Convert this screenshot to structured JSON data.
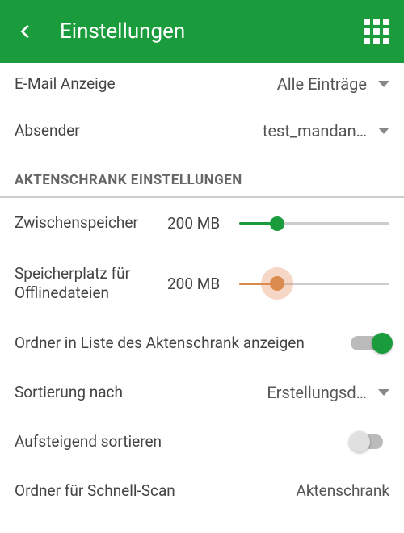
{
  "header": {
    "title": "Einstellungen"
  },
  "email_row": {
    "label": "E-Mail Anzeige",
    "value": "Alle Einträge"
  },
  "sender_row": {
    "label": "Absender",
    "value": "test_mandan…"
  },
  "section": "AKTENSCHRANK EINSTELLUNGEN",
  "cache": {
    "label": "Zwischenspeicher",
    "value": "200 MB",
    "pct": 25,
    "color": "#1a9c3c"
  },
  "offline": {
    "label": "Speicherplatz für Offlinedateien",
    "value": "200 MB",
    "pct": 25,
    "color": "#d88a4a"
  },
  "folder_switch": {
    "label": "Ordner in Liste des Aktenschrank anzeigen",
    "on": true
  },
  "sort_row": {
    "label": "Sortierung nach",
    "value": "Erstellungsd…"
  },
  "asc_switch": {
    "label": "Aufsteigend sortieren",
    "on": false
  },
  "quickscan": {
    "label": "Ordner für Schnell-Scan",
    "value": "Aktenschrank"
  }
}
